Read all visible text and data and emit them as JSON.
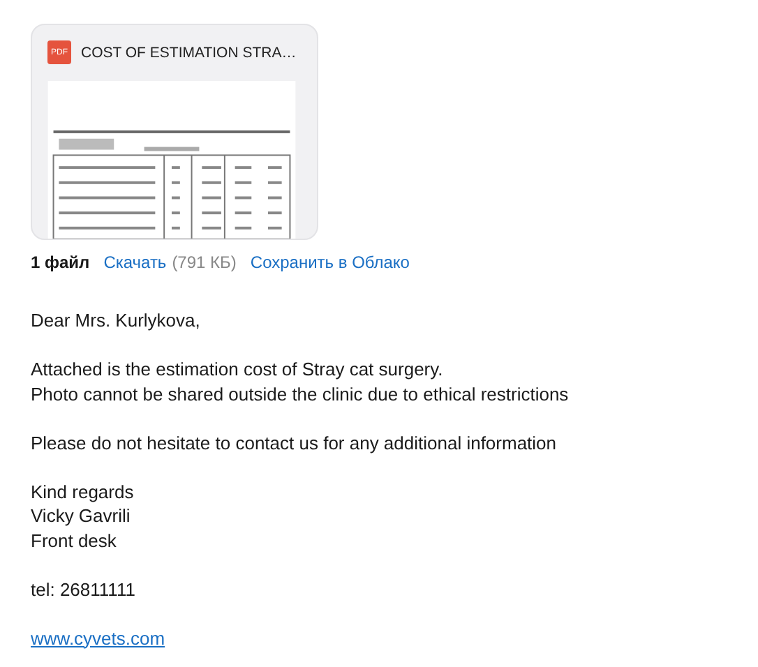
{
  "attachment": {
    "file_type": "PDF",
    "name": "COST OF ESTIMATION STRA…"
  },
  "attachment_bar": {
    "count": "1 файл",
    "download": "Скачать",
    "size": "(791 КБ)",
    "save": "Сохранить в Облако"
  },
  "body": [
    {
      "lines": [
        "Dear Mrs. Kurlykova,"
      ]
    },
    {
      "lines": [
        "Attached is the estimation cost of Stray cat surgery.",
        "Photo cannot be shared outside the clinic due to ethical restrictions"
      ]
    },
    {
      "lines": [
        "Please do not hesitate to contact us for any additional information"
      ]
    },
    {
      "lines": [
        "Kind regards",
        "Vicky Gavrili",
        "Front desk"
      ]
    },
    {
      "lines": [
        "tel: 26811111"
      ]
    }
  ],
  "link": "www.cyvets.com"
}
